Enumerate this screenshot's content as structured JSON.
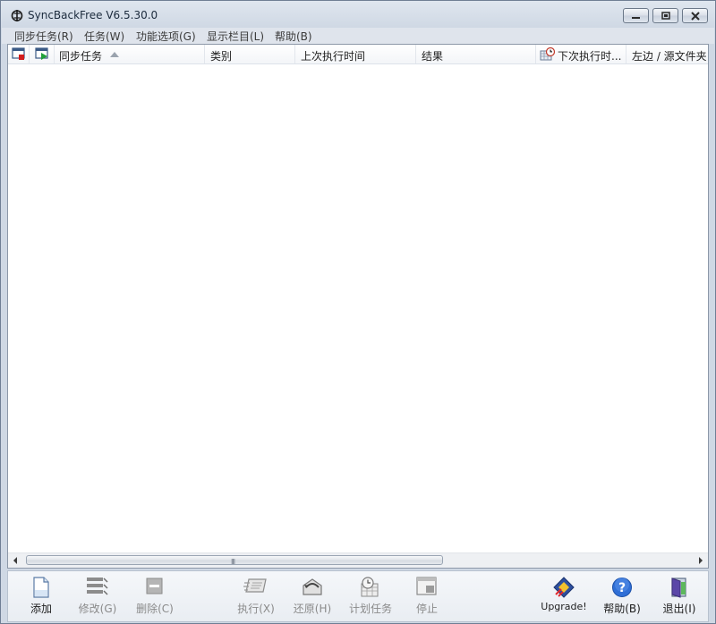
{
  "window": {
    "title": "SyncBackFree V6.5.30.0",
    "controls": {
      "minimize": "minimize-icon",
      "maximize": "maximize-icon",
      "close": "close-icon"
    }
  },
  "menubar": [
    "同步任务(R)",
    "任务(W)",
    "功能选项(G)",
    "显示栏目(L)",
    "帮助(B)"
  ],
  "columns": {
    "icon1": "delete-profile-icon",
    "icon2": "run-profile-icon",
    "name": "同步任务",
    "sort": "ascending",
    "type": "类别",
    "last_run": "上次执行时间",
    "result": "结果",
    "next_run": "下次执行时...",
    "source": "左边 / 源文件夹"
  },
  "rows": [],
  "scrollbar": {
    "grip": "III"
  },
  "toolbar": {
    "add": "添加",
    "modify": "修改(G)",
    "delete": "删除(C)",
    "run": "执行(X)",
    "restore": "还原(H)",
    "schedule": "计划任务",
    "stop": "停止",
    "upgrade": "Upgrade!",
    "help": "帮助(B)",
    "exit": "退出(I)"
  },
  "colors": {
    "window_frame": "#cfd8e4",
    "list_bg": "#ffffff",
    "disabled_text": "#8a8a8a"
  }
}
